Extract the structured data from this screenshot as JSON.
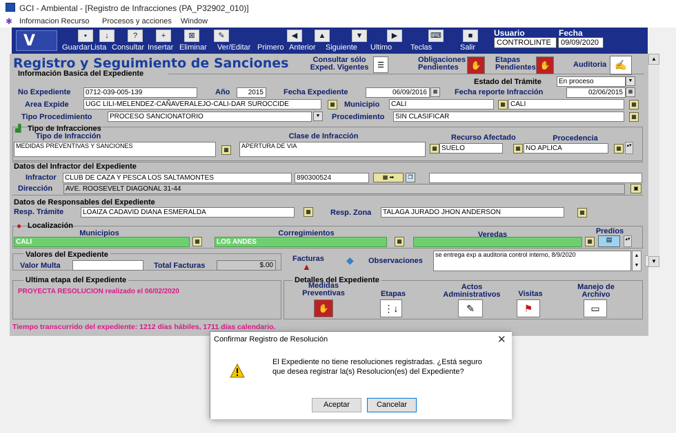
{
  "window": {
    "title": "GCI - Ambiental - [Registro de Infracciones (PA_P32902_010)]"
  },
  "menu": [
    "Informacion Recurso",
    "Procesos y acciones",
    "Window"
  ],
  "toolbar": {
    "buttons": [
      "Guardar",
      "Lista",
      "Consultar",
      "Insertar",
      "Eliminar",
      "Ver/Editar",
      "Primero",
      "Anterior",
      "Siguiente",
      "Ultimo",
      "Teclas",
      "Salir"
    ],
    "user_label": "Usuario",
    "user_value": "CONTROLINTE",
    "date_label": "Fecha",
    "date_value": "09/09/2020"
  },
  "header": {
    "title": "Registro y Seguimiento de Sanciones",
    "consultar_vigentes": "Consultar sólo Exped. Vigentes",
    "obligaciones": "Obligaciones Pendientes",
    "etapas": "Etapas Pendientes",
    "auditoria": "Auditoria"
  },
  "basic": {
    "section_title": "Información Basica del Expediente",
    "estado_label": "Estado del Trámite",
    "estado_value": "En proceso",
    "no_exp_label": "No Expediente",
    "no_exp_value": "0712-039-005-139",
    "anio_label": "Año",
    "anio_value": "2015",
    "fecha_exp_label": "Fecha Expediente",
    "fecha_exp_value": "06/09/2016",
    "fecha_rep_label": "Fecha reporte Infracción",
    "fecha_rep_value": "02/06/2015",
    "area_label": "Area Expide",
    "area_value": "UGC LILI-MELENDEZ-CAÑAVERALEJO-CALI-DAR SUROCCIDE",
    "municipio_label": "Municipio",
    "municipio_value": "CALI",
    "municipio_value2": "CALI",
    "tipo_proc_label": "Tipo Procedimiento",
    "tipo_proc_value": "PROCESO SANCIONATORIO",
    "procedimiento_label": "Procedimiento",
    "procedimiento_value": "SIN CLASIFICAR"
  },
  "infracciones": {
    "title": "Tipo de Infracciones",
    "col_tipo": "Tipo de Infracción",
    "col_clase": "Clase de Infracción",
    "col_recurso": "Recurso Afectado",
    "col_procedencia": "Procedencia",
    "tipo_value": "MEDIDAS PREVENTIVAS Y SANCIONES",
    "clase_value": "APERTURA DE VIA",
    "recurso_value": "SUELO",
    "procedencia_value": "NO APLICA"
  },
  "infractor": {
    "section_title": "Datos del Infractor del Expediente",
    "infractor_label": "Infractor",
    "infractor_value": "CLUB DE CAZA Y PESCA LOS SALTAMONTES",
    "nit_value": "890300524",
    "direccion_label": "Dirección",
    "direccion_value": "AVE. ROOSEVELT DIAGONAL 31-44"
  },
  "responsables": {
    "section_title": "Datos de Responsables del Expediente",
    "tramite_label": "Resp. Trámite",
    "tramite_value": "LOAIZA CADAVID DIANA ESMERALDA",
    "zona_label": "Resp. Zona",
    "zona_value": "TALAGA JURADO JHON ANDERSON"
  },
  "localizacion": {
    "title": "Localización",
    "col_municipios": "Municipios",
    "col_corregimientos": "Corregimientos",
    "col_veredas": "Veredas",
    "col_predios": "Predios",
    "municipio_value": "CALI",
    "corregimiento_value": "LOS ANDES"
  },
  "valores": {
    "title": "Valores del Expediente",
    "multa_label": "Valor Multa",
    "facturas_total_label": "Total Facturas",
    "facturas_total_value": "$.00",
    "facturas_label": "Facturas",
    "observaciones_label": "Observaciones",
    "observaciones_value": "se entrega exp a auditoria control interno, 8/9/2020"
  },
  "ultima_etapa": {
    "title": "Ultima etapa del Expediente",
    "value": "PROYECTA RESOLUCION realizado el 06/02/2020"
  },
  "detalles": {
    "title": "Detalles del Expediente",
    "medidas": "Medidas Preventivas",
    "etapas": "Etapas",
    "actos": "Actos Administrativos",
    "visitas": "Visitas",
    "manejo": "Manejo de Archivo"
  },
  "status": {
    "tiempo": "Tiempo transcurrido del expediente: 1212 días hábiles, 1711 días calendario."
  },
  "dialog": {
    "title": "Confirmar Registro de Resolución",
    "message": "El Expediente no tiene resoluciones registradas. ¿Está seguro que desea registrar la(s) Resolucion(es) del Expediente?",
    "accept": "Aceptar",
    "cancel": "Cancelar"
  },
  "colors": {
    "toolbar": "#1a2e8a",
    "form_bg": "#c0c0c0",
    "title_blue": "#1a3ea0",
    "status_pink": "#d91a8a",
    "green_field": "#6ecf6e"
  }
}
